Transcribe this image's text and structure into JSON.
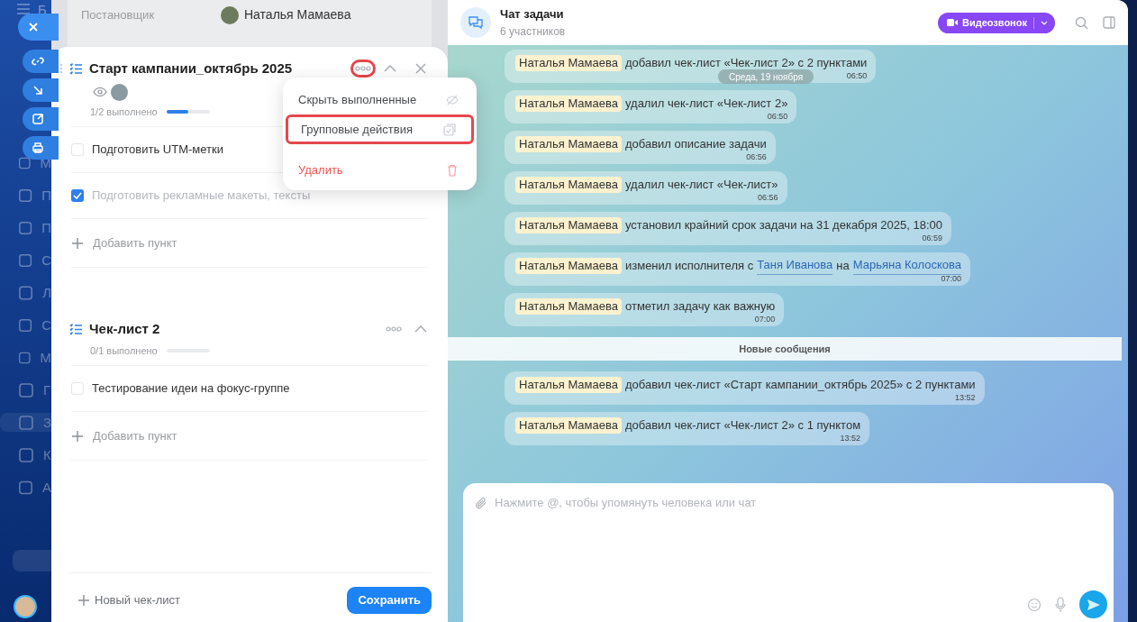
{
  "sidebar": {
    "top_label": "Б",
    "labels": [
      "М",
      "П",
      "П",
      "С",
      "Л",
      "С",
      "М",
      "Г",
      "З",
      "К",
      "А"
    ]
  },
  "task_fields": [
    {
      "label": "Постановщик",
      "value": "Наталья Мамаева"
    }
  ],
  "checklists": [
    {
      "title": "Старт кампании_октябрь 2025",
      "progress": "1/2 выполнено",
      "level": 0.5,
      "menu_open": true,
      "menu_highlighted": true,
      "show_watchers": true,
      "closable": true,
      "items": [
        {
          "text": "Подготовить UTM-метки",
          "checked": false
        },
        {
          "text": "Подготовить рекламные макеты, тексты",
          "checked": true
        }
      ],
      "add_item": "Добавить пункт"
    },
    {
      "title": "Чек-лист 2",
      "progress": "0/1 выполнено",
      "level": 0,
      "menu_open": false,
      "menu_highlighted": false,
      "show_watchers": false,
      "closable": false,
      "items": [
        {
          "text": "Тестирование идеи на фокус-группе",
          "checked": false
        }
      ],
      "add_item": "Добавить пункт"
    }
  ],
  "menu": {
    "items": [
      {
        "label": "Скрыть выполненные",
        "kind": "hide",
        "highlighted": false
      },
      {
        "label": "Групповые действия",
        "kind": "group",
        "highlighted": true
      },
      {
        "label": "Удалить",
        "kind": "delete",
        "highlighted": false
      }
    ]
  },
  "new_checklist": "Новый чек-лист",
  "save": "Сохранить",
  "chat": {
    "title": "Чат задачи",
    "subtitle": "6 участников",
    "call": "Видеозвонок",
    "date": "Среда, 19 ноября",
    "messages": [
      {
        "kind": "message",
        "author": "Наталья Мамаева",
        "parts": [
          {
            "kind": "text",
            "text": "добавил чек-лист «Чек-лист 2» с 2 пунктами"
          }
        ],
        "time": "06:50"
      },
      {
        "kind": "message",
        "author": "Наталья Мамаева",
        "parts": [
          {
            "kind": "text",
            "text": "удалил чек-лист «Чек-лист 2»"
          }
        ],
        "time": "06:50"
      },
      {
        "kind": "message",
        "author": "Наталья Мамаева",
        "parts": [
          {
            "kind": "text",
            "text": "добавил описание задачи"
          }
        ],
        "time": "06:56"
      },
      {
        "kind": "message",
        "author": "Наталья Мамаева",
        "parts": [
          {
            "kind": "text",
            "text": "удалил чек-лист «Чек-лист»"
          }
        ],
        "time": "06:56"
      },
      {
        "kind": "message",
        "author": "Наталья Мамаева",
        "parts": [
          {
            "kind": "text",
            "text": "установил крайний срок задачи на 31 декабря 2025, 18:00"
          }
        ],
        "time": "06:59"
      },
      {
        "kind": "message",
        "author": "Наталья Мамаева",
        "parts": [
          {
            "kind": "text",
            "text": "изменил исполнителя с"
          },
          {
            "kind": "link",
            "text": "Таня Иванова"
          },
          {
            "kind": "text",
            "text": "на"
          },
          {
            "kind": "link",
            "text": "Марьяна Колоскова"
          }
        ],
        "time": "07:00"
      },
      {
        "kind": "message",
        "author": "Наталья Мамаева",
        "parts": [
          {
            "kind": "text",
            "text": "отметил задачу как важную"
          }
        ],
        "time": "07:00"
      },
      {
        "kind": "divider",
        "text": "Новые сообщения"
      },
      {
        "kind": "message",
        "author": "Наталья Мамаева",
        "parts": [
          {
            "kind": "text",
            "text": "добавил чек-лист «Старт кампании_октябрь 2025» с 2 пунктами"
          }
        ],
        "time": "13:52"
      },
      {
        "kind": "message",
        "author": "Наталья Мамаева",
        "parts": [
          {
            "kind": "text",
            "text": "добавил чек-лист «Чек-лист 2» с 1 пунктом"
          }
        ],
        "time": "13:52"
      }
    ],
    "input": {
      "placeholder": "Нажмите @, чтобы упомянуть человека или чат"
    }
  }
}
